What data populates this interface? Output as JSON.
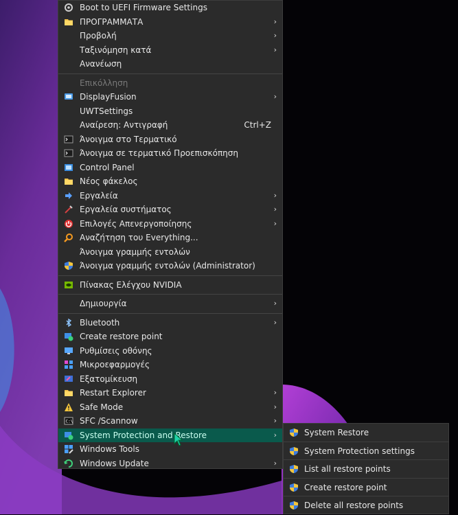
{
  "main_menu": {
    "items": [
      {
        "label": "Boot to UEFI Firmware Settings",
        "icon": "gear-icon"
      },
      {
        "label": "ΠΡΟΓΡΑΜΜΑΤΑ",
        "icon": "folder-icon",
        "submenu": true
      },
      {
        "label": "Προβολή",
        "submenu": true
      },
      {
        "label": "Ταξινόμηση κατά",
        "submenu": true
      },
      {
        "label": "Ανανέωση"
      },
      {
        "label": "Επικόλληση",
        "disabled": true
      },
      {
        "label": "DisplayFusion",
        "icon": "displayfusion-icon",
        "submenu": true
      },
      {
        "label": "UWTSettings"
      },
      {
        "label": "Αναίρεση: Αντιγραφή",
        "shortcut": "Ctrl+Z"
      },
      {
        "label": "Άνοιγμα στο Τερματικό",
        "icon": "terminal-icon"
      },
      {
        "label": "Άνοιγμα σε τερματικό Προεπισκόπηση",
        "icon": "terminal-icon"
      },
      {
        "label": "Control Panel",
        "icon": "control-panel-icon"
      },
      {
        "label": "Νέος φάκελος",
        "icon": "folder-icon"
      },
      {
        "label": "Εργαλεία",
        "icon": "arrow-icon",
        "submenu": true
      },
      {
        "label": "Εργαλεία συστήματος",
        "icon": "tools-icon",
        "submenu": true
      },
      {
        "label": "Επιλογές Απενεργοποίησης",
        "icon": "power-icon",
        "submenu": true
      },
      {
        "label": "Αναζήτηση του Everything...",
        "icon": "magnifier-icon"
      },
      {
        "label": "Άνοιγμα γραμμής εντολών"
      },
      {
        "label": "Άνοιγμα γραμμής εντολών (Administrator)",
        "icon": "shield-icon"
      },
      {
        "label": "Πίνακας Ελέγχου NVIDIA",
        "icon": "nvidia-icon"
      },
      {
        "label": "Δημιουργία",
        "submenu": true
      },
      {
        "label": "Bluetooth",
        "icon": "bluetooth-icon",
        "submenu": true
      },
      {
        "label": "Create restore point",
        "icon": "restore-icon"
      },
      {
        "label": "Ρυθμίσεις οθόνης",
        "icon": "display-icon"
      },
      {
        "label": "Μικροεφαρμογές",
        "icon": "widgets-icon"
      },
      {
        "label": "Εξατομίκευση",
        "icon": "personalize-icon"
      },
      {
        "label": "Restart Explorer",
        "icon": "folder-icon",
        "submenu": true
      },
      {
        "label": "Safe Mode",
        "icon": "warning-icon",
        "submenu": true
      },
      {
        "label": "SFC /Scannow",
        "icon": "cmd-icon",
        "submenu": true
      },
      {
        "label": "System Protection and Restore",
        "icon": "restore-icon",
        "submenu": true,
        "highlighted": true
      },
      {
        "label": "Windows Tools",
        "icon": "windows-tools-icon"
      },
      {
        "label": "Windows Update",
        "icon": "windows-update-icon",
        "submenu": true
      }
    ],
    "submenu_arrow": "›"
  },
  "sub_menu": {
    "items": [
      {
        "label": "System Restore",
        "icon": "shield-icon"
      },
      {
        "label": "System Protection settings",
        "icon": "shield-icon"
      },
      {
        "label": "List all restore points",
        "icon": "shield-icon"
      },
      {
        "label": "Create restore point",
        "icon": "shield-icon"
      },
      {
        "label": "Delete all restore points",
        "icon": "shield-icon"
      }
    ]
  },
  "colors": {
    "menu_bg": "#2b2b2b",
    "highlight_bg": "#0a5a4c",
    "highlight_text": "#c9fff0",
    "text": "#e8e8e8",
    "disabled_text": "#7a7a7a"
  }
}
